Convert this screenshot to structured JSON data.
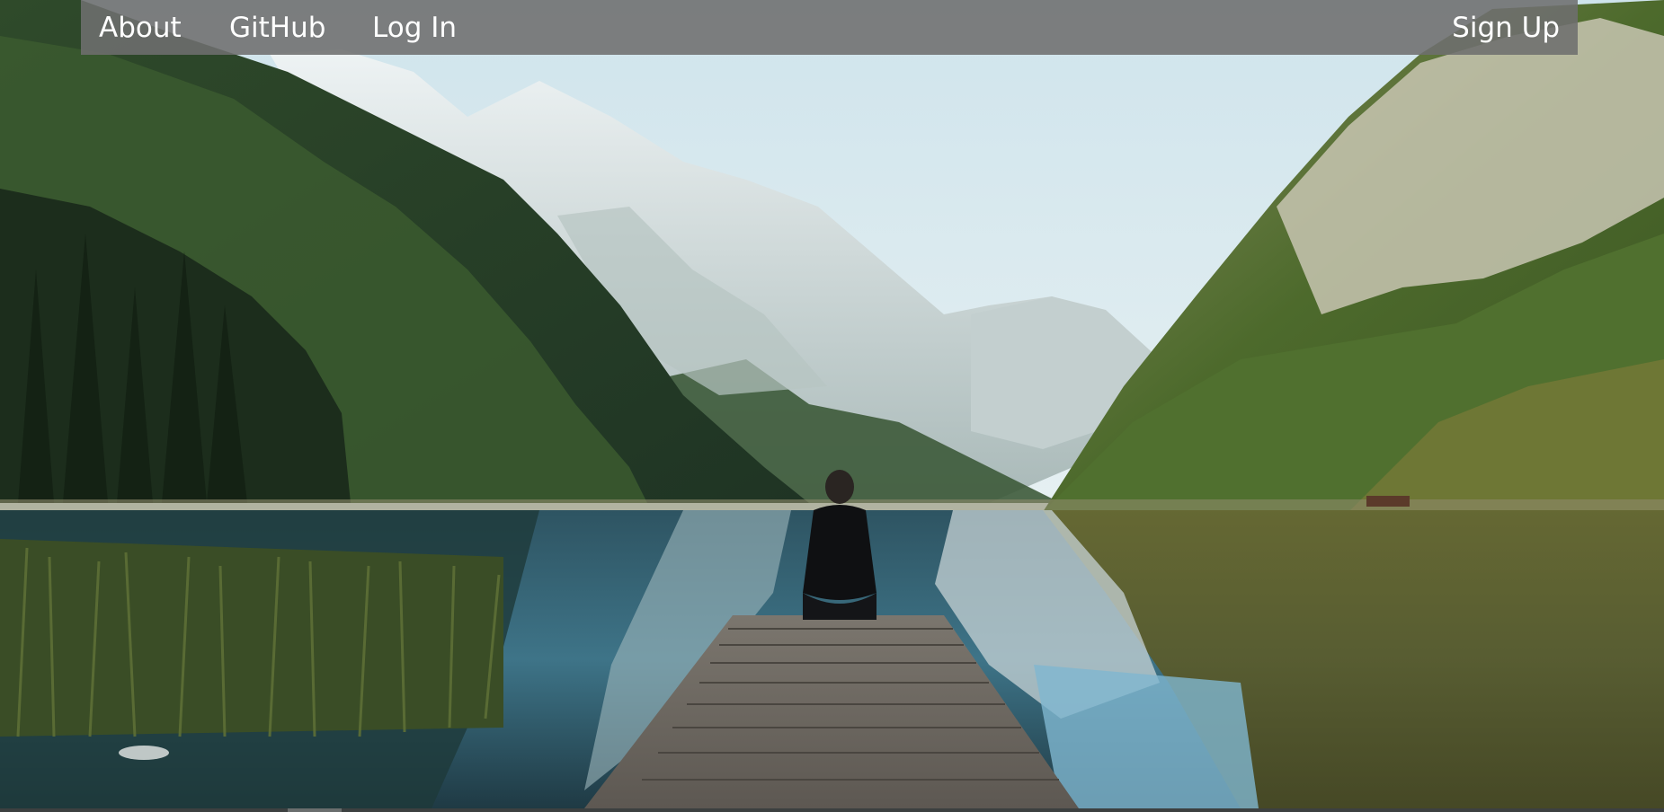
{
  "nav": {
    "left_links": [
      {
        "label": "About"
      },
      {
        "label": "GitHub"
      },
      {
        "label": "Log In"
      }
    ],
    "right_links": [
      {
        "label": "Sign Up"
      }
    ]
  },
  "hero": {
    "scene": "mountain-lake-with-person-on-dock",
    "colors": {
      "sky": "#dcebf0",
      "water_blue": "#4f8ea6",
      "forest_green": "#3f5e32",
      "dock_wood": "#6f6a62"
    }
  }
}
